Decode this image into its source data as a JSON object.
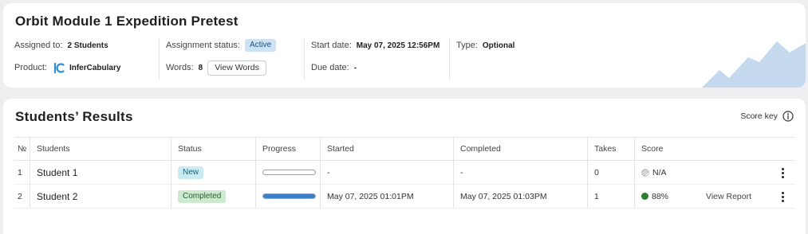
{
  "assignment": {
    "title": "Orbit Module 1 Expedition Pretest",
    "assigned_to_label": "Assigned to:",
    "assigned_to_value": "2 Students",
    "product_label": "Product:",
    "product_value": "InferCabulary",
    "status_label": "Assignment status:",
    "status_value": "Active",
    "words_label": "Words:",
    "words_value": "8",
    "view_words_label": "View Words",
    "start_label": "Start date:",
    "start_value": "May 07, 2025 12:56PM",
    "due_label": "Due date:",
    "due_value": "-",
    "type_label": "Type:",
    "type_value": "Optional"
  },
  "results": {
    "title": "Students’ Results",
    "score_key_label": "Score key",
    "columns": [
      "№",
      "Students",
      "Status",
      "Progress",
      "Started",
      "Completed",
      "Takes",
      "Score"
    ],
    "rows": [
      {
        "num": "1",
        "student": "Student 1",
        "status": "New",
        "progress": 0,
        "started": "-",
        "completed": "-",
        "takes": "0",
        "score": "N/A",
        "score_kind": "na",
        "action": ""
      },
      {
        "num": "2",
        "student": "Student 2",
        "status": "Completed",
        "progress": 1,
        "started": "May 07, 2025 01:01PM",
        "completed": "May 07, 2025 01:03PM",
        "takes": "1",
        "score": "88%",
        "score_kind": "pass",
        "action": "View Report"
      }
    ]
  },
  "colors": {
    "active_badge": "#cce3f6",
    "new_badge": "#c9ecf2",
    "completed_badge": "#cde9cf",
    "progress_fill": "#3b7ec5",
    "score_pass": "#2e7d32",
    "mountain": "#c5d9ee"
  },
  "icons": {
    "product": "infercabulary-logo-icon",
    "score_key": "info-icon",
    "na_score": "striped-circle-icon",
    "row_menu": "kebab-menu-icon",
    "decoration": "mountain-illustration"
  }
}
